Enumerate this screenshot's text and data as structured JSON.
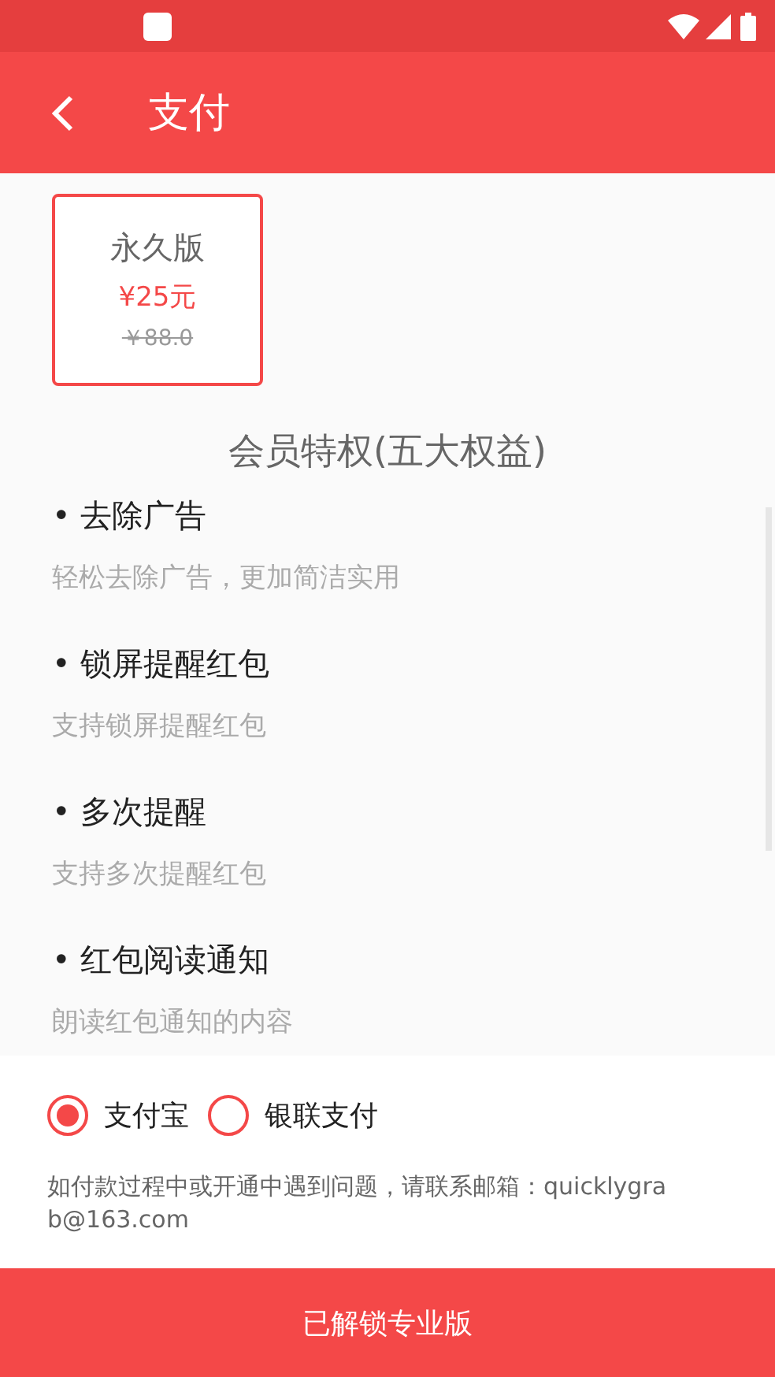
{
  "app_bar": {
    "title": "支付"
  },
  "plans": [
    {
      "name": "永久版",
      "price": "¥25元",
      "original_price": "￥88.0",
      "selected": true
    }
  ],
  "benefits_title": "会员特权(五大权益)",
  "benefits": [
    {
      "title": "• 去除广告",
      "description": "轻松去除广告，更加简洁实用"
    },
    {
      "title": "• 锁屏提醒红包",
      "description": "支持锁屏提醒红包"
    },
    {
      "title": "• 多次提醒",
      "description": "支持多次提醒红包"
    },
    {
      "title": "• 红包阅读通知",
      "description": "朗读红包通知的内容"
    }
  ],
  "payment_methods": [
    {
      "label": "支付宝",
      "selected": true
    },
    {
      "label": "银联支付",
      "selected": false
    }
  ],
  "contact_note": "如付款过程中或开通中遇到问题，请联系邮箱：quicklygrab@163.com",
  "unlock_button": "已解锁专业版"
}
